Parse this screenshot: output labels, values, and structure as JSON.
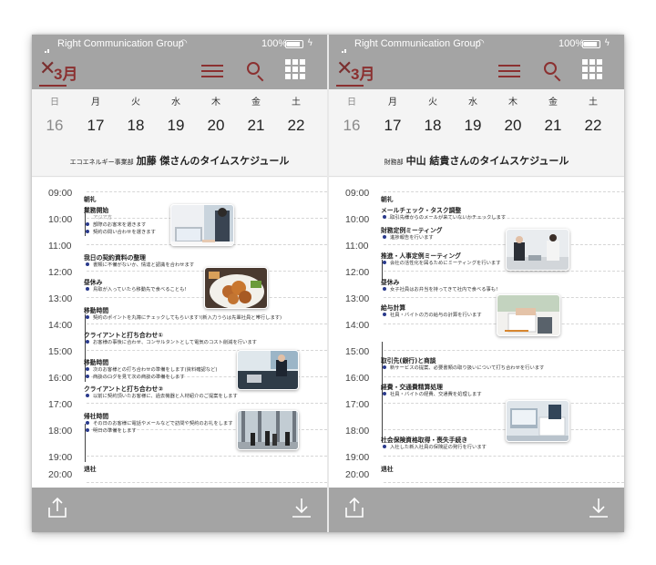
{
  "status": {
    "carrier": "Right Communication Group",
    "battery": "100%"
  },
  "nav": {
    "month": "3月"
  },
  "week": {
    "days": [
      {
        "dow": "日",
        "num": "16"
      },
      {
        "dow": "月",
        "num": "17"
      },
      {
        "dow": "火",
        "num": "18"
      },
      {
        "dow": "水",
        "num": "19"
      },
      {
        "dow": "木",
        "num": "20"
      },
      {
        "dow": "金",
        "num": "21"
      },
      {
        "dow": "土",
        "num": "22"
      }
    ]
  },
  "times": [
    "09:00",
    "10:00",
    "11:00",
    "12:00",
    "13:00",
    "14:00",
    "15:00",
    "16:00",
    "17:00",
    "18:00",
    "19:00",
    "20:00"
  ],
  "left": {
    "dept": "エコエネルギー事業部",
    "person": "加藤 傑さんのタイムスケジュール",
    "events": [
      {
        "title": "朝礼",
        "notes": []
      },
      {
        "title": "業務開始",
        "notes": [
          "アジア方",
          "部際のお客末を選きます",
          "契約の問い合わせを選きます"
        ]
      },
      {
        "title": "我日の契約資料の整理",
        "notes": [
          "書類に不備がないか、情達と認識を合わせます"
        ]
      },
      {
        "title": "昼休み",
        "notes": [
          "鳥取が入っていたら移動先で食べることも!"
        ]
      },
      {
        "title": "移動時間",
        "notes": [
          "契約のポイントを丸簿にチェックしてもらいます!(新入力うらは先輩社員と帯行します)"
        ]
      },
      {
        "title": "クライアントと打ち合わせ①",
        "notes": [
          "お客様の事後に合わせ、コンサルタントとして電気のコスト削減を行います"
        ]
      },
      {
        "title": "移動時間",
        "notes": [
          "次のお客様との打ち合わせの準備をします(資料確認など)",
          "商談のログを見て次の商談の準備をします"
        ]
      },
      {
        "title": "クライアントと打ち合わせ②",
        "notes": [
          "以前に契約頂いたお客様に、過去機器と人材紹介のご提案をします"
        ]
      },
      {
        "title": "帰社時間",
        "notes": [
          "その日のお客様に電話やメールなどで訪問や契約のお礼をします",
          "明日の準備をします"
        ]
      },
      {
        "title": "退社",
        "notes": []
      }
    ]
  },
  "right": {
    "dept": "財務部",
    "person": "中山 結貴さんのタイムスケジュール",
    "events": [
      {
        "title": "朝礼",
        "notes": []
      },
      {
        "title": "メールチェック・タスク調整",
        "notes": [
          "取引先様からのメールが来ていないかチェックします"
        ]
      },
      {
        "title": "財務定例ミーティング",
        "notes": [
          "進捗報告を行います"
        ]
      },
      {
        "title": "推進・人事定例ミーティング",
        "notes": [
          "会社の活性化を図るためにミーティングを行います"
        ]
      },
      {
        "title": "昼休み",
        "notes": [
          "女子社員はお弁当を持ってきて社内で食べる事も!"
        ]
      },
      {
        "title": "給与計算",
        "notes": [
          "社員・バイトの方の給与の計算を行います"
        ]
      },
      {
        "title": "取引先(銀行)と商談",
        "notes": [
          "新サービスの提案、必要書類の取り扱いについて打ち合わせを行います"
        ]
      },
      {
        "title": "経費・交通費精算処理",
        "notes": [
          "社員・バイトの経費、交通費を処理します"
        ]
      },
      {
        "title": "社会保険資格取得・喪失手続き",
        "notes": [
          "入社した新入社員の保険証の発行を行います"
        ]
      },
      {
        "title": "退社",
        "notes": []
      }
    ]
  },
  "colors": {
    "bar": "#a4a4a4",
    "accent": "#8b3030",
    "bullet": "#2a3a8c"
  }
}
